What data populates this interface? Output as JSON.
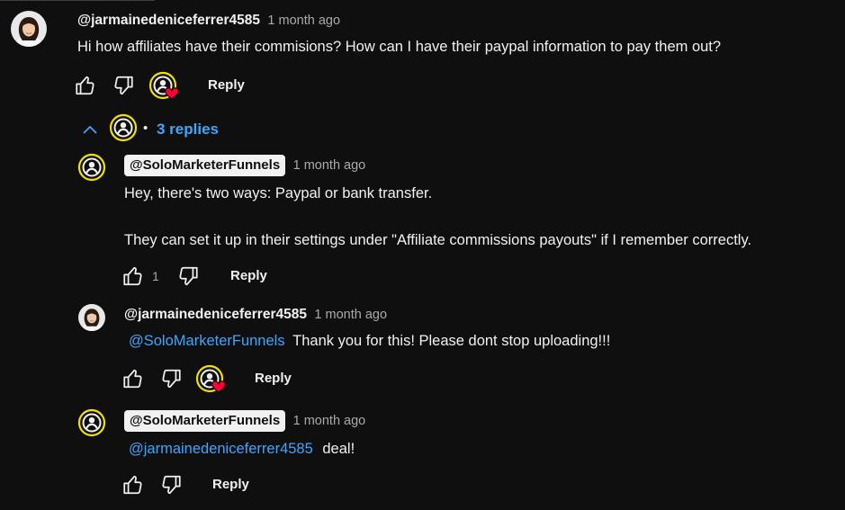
{
  "comment": {
    "author": "@jarmainedeniceferrer4585",
    "time": "1 month ago",
    "text": "Hi how affiliates have their commisions? How can I have their paypal information to pay them out?",
    "reply_label": "Reply"
  },
  "replies_toggle": {
    "separator": "•",
    "label": "3 replies"
  },
  "replies": [
    {
      "author": "@SoloMarketerFunnels",
      "time": "1 month ago",
      "line1": "Hey, there's two ways: Paypal or bank transfer.",
      "line2": "They can set it up in their settings under \"Affiliate commissions payouts\" if I remember correctly.",
      "likes": "1",
      "reply_label": "Reply"
    },
    {
      "author": "@jarmainedeniceferrer4585",
      "time": "1 month ago",
      "mention": "@SoloMarketerFunnels",
      "text": "Thank you for this! Please dont stop uploading!!!",
      "reply_label": "Reply"
    },
    {
      "author": "@SoloMarketerFunnels",
      "time": "1 month ago",
      "mention": "@jarmainedeniceferrer4585",
      "text": "deal!",
      "reply_label": "Reply"
    }
  ],
  "icons": {
    "like": "thumbs-up-icon",
    "dislike": "thumbs-down-icon",
    "creator_heart": "creator-heart-badge",
    "collapse": "chevron-up-icon",
    "channel_avatar": "person-avatar-icon"
  },
  "colors": {
    "background": "#0f0f0f",
    "text": "#f1f1f1",
    "secondary_text": "#aaaaaa",
    "link": "#3ea6ff",
    "avatar_ring": "#f0e100",
    "heart": "#ff0033"
  }
}
